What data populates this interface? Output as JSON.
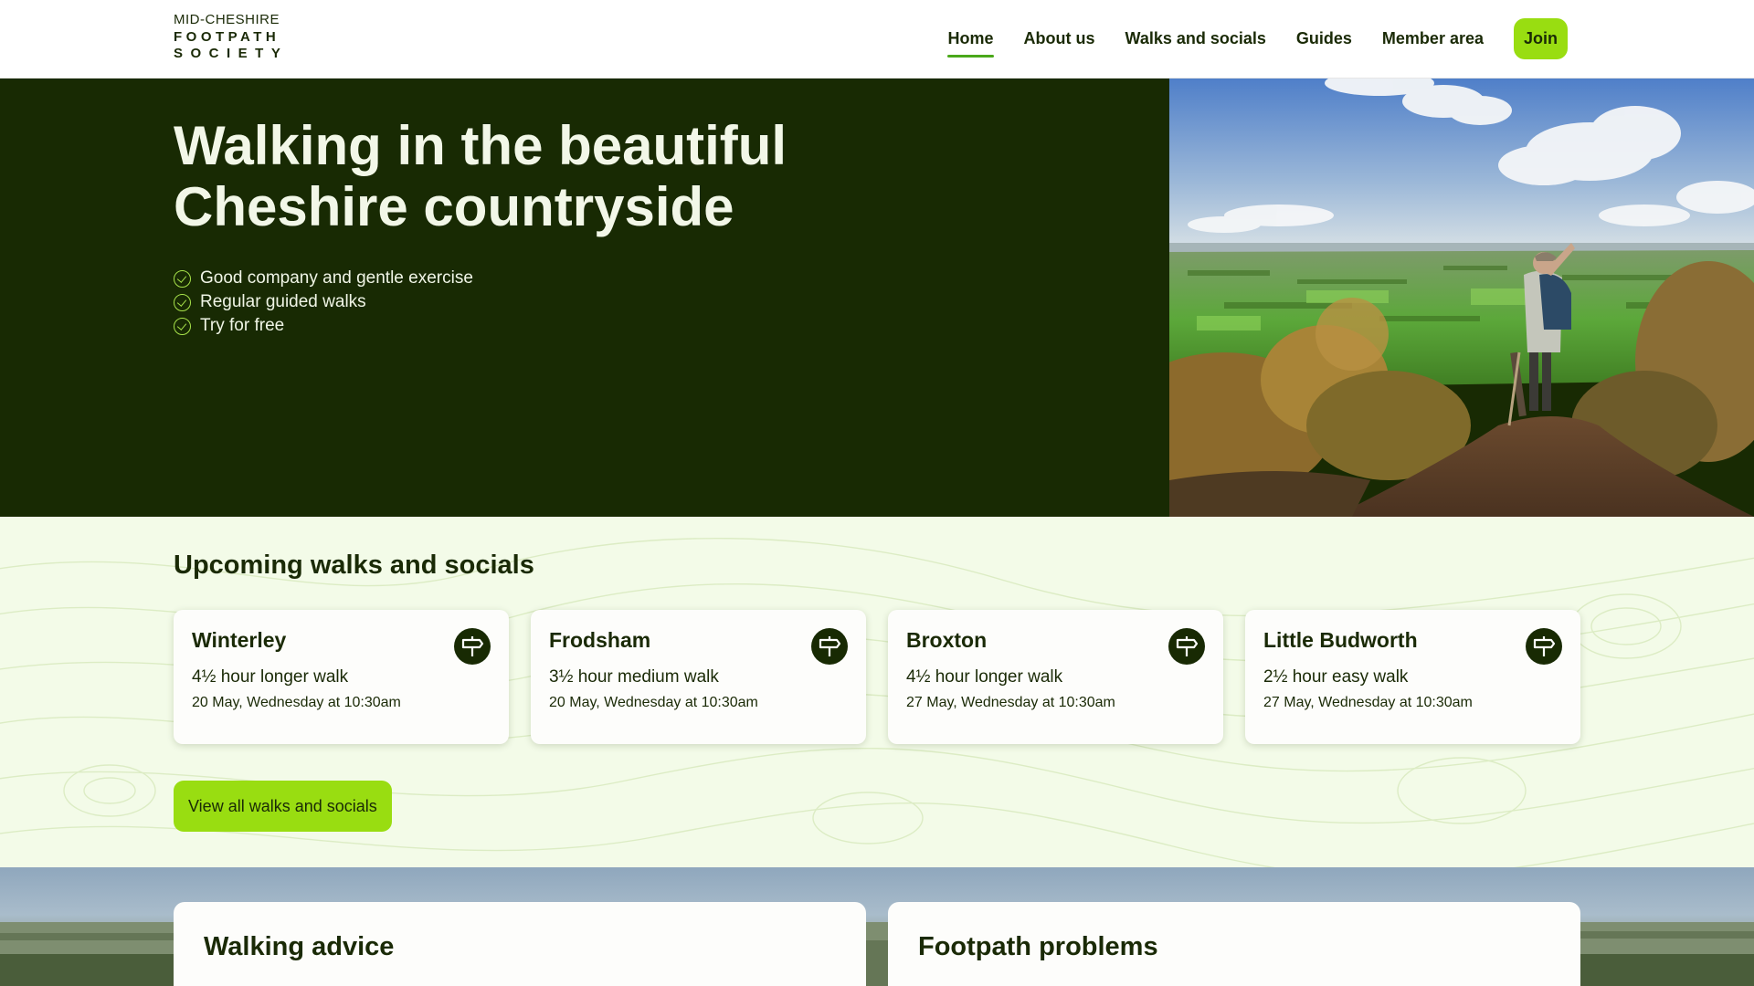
{
  "logo": {
    "line1": "MID-CHESHIRE",
    "line2": "FOOTPATH",
    "line3": "SOCIETY"
  },
  "nav": {
    "items": [
      "Home",
      "About us",
      "Walks and socials",
      "Guides",
      "Member area"
    ],
    "join": "Join",
    "active": "Home"
  },
  "hero": {
    "title": "Walking in the beautiful Cheshire countryside",
    "bullets": [
      "Good company and gentle exercise",
      "Regular guided walks",
      "Try for free"
    ]
  },
  "upcoming": {
    "heading": "Upcoming walks and socials",
    "cards": [
      {
        "title": "Winterley",
        "duration": "4½ hour longer walk",
        "date": "20 May, Wednesday at 10:30am"
      },
      {
        "title": "Frodsham",
        "duration": "3½ hour medium walk",
        "date": "20 May, Wednesday at 10:30am"
      },
      {
        "title": "Broxton",
        "duration": "4½ hour longer walk",
        "date": "27 May, Wednesday at 10:30am"
      },
      {
        "title": "Little Budworth",
        "duration": "2½ hour easy walk",
        "date": "27 May, Wednesday at 10:30am"
      }
    ],
    "view_all": "View all walks and socials"
  },
  "panels": {
    "left": "Walking advice",
    "right": "Footpath problems"
  },
  "colors": {
    "dark_green": "#182a03",
    "lime": "#99dd11",
    "pale_green": "#f3fbe8"
  },
  "icons": {
    "bullet": "check-circle-icon",
    "card": "signpost-icon"
  }
}
